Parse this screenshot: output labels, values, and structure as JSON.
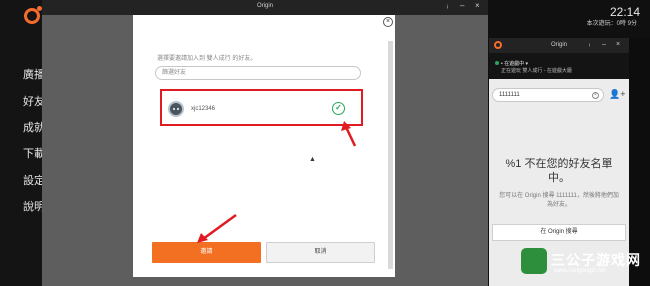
{
  "left_nav": {
    "items": [
      "廣播",
      "好友",
      "成就",
      "下載",
      "設定",
      "說明"
    ]
  },
  "main_window": {
    "title": "Origin",
    "controls": [
      "ᵢ",
      "‒",
      "×"
    ]
  },
  "invite_dialog": {
    "close_glyph": "×",
    "prompt": "選擇要邀請加入到 雙人成行 的好友。",
    "search_placeholder": "篩選好友",
    "friend": {
      "name": "xjc12346",
      "selected": true
    },
    "invite_label": "邀請",
    "cancel_label": "取消"
  },
  "system": {
    "time": "22:14",
    "online_status": "本次遊玩：0時 9分"
  },
  "chat_panel": {
    "title": "Origin",
    "controls": [
      "ᵢ",
      "‒",
      "×"
    ],
    "status_title": "• 在遊戲中 ▾",
    "status_subtitle": "正在遊玩 雙人成行 - 在遊戲大廳",
    "search_value": "1111111",
    "not_friend": "%1 不在您的好友名單中。",
    "search_hint": "您可以在 Origin 搜尋 1111111，然後將他們加為好友。",
    "origin_search_label": "在 Origin 搜尋"
  },
  "watermark": {
    "name": "三公子游戏网",
    "url": "www.sangongzi.net"
  },
  "colors": {
    "accent_orange": "#f36f22",
    "highlight_red": "#e01b22",
    "check_green": "#2aa657"
  }
}
